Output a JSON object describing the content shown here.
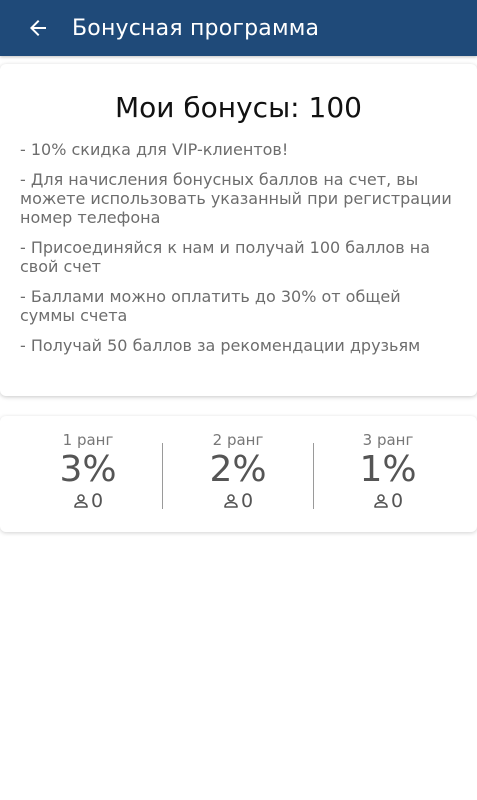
{
  "header": {
    "title": "Бонусная программа",
    "back_icon": "arrow-left-icon",
    "background": "#1f4a79"
  },
  "bonus": {
    "heading": "Мои бонусы: 100",
    "rules": [
      "- 10% скидка для VIP-клиентов!",
      "- Для начисления бонусных баллов на счет, вы можете использовать указанный при регистрации номер телефона",
      "- Присоединяйся к нам и получай 100 баллов на свой счет",
      "- Баллами можно оплатить до 30% от общей суммы счета",
      "- Получай 50 баллов за рекомендации друзьям"
    ]
  },
  "ranks": [
    {
      "label": "1 ранг",
      "percent": "3%",
      "count": "0",
      "icon": "person-icon"
    },
    {
      "label": "2 ранг",
      "percent": "2%",
      "count": "0",
      "icon": "person-icon"
    },
    {
      "label": "3 ранг",
      "percent": "1%",
      "count": "0",
      "icon": "person-icon"
    }
  ]
}
